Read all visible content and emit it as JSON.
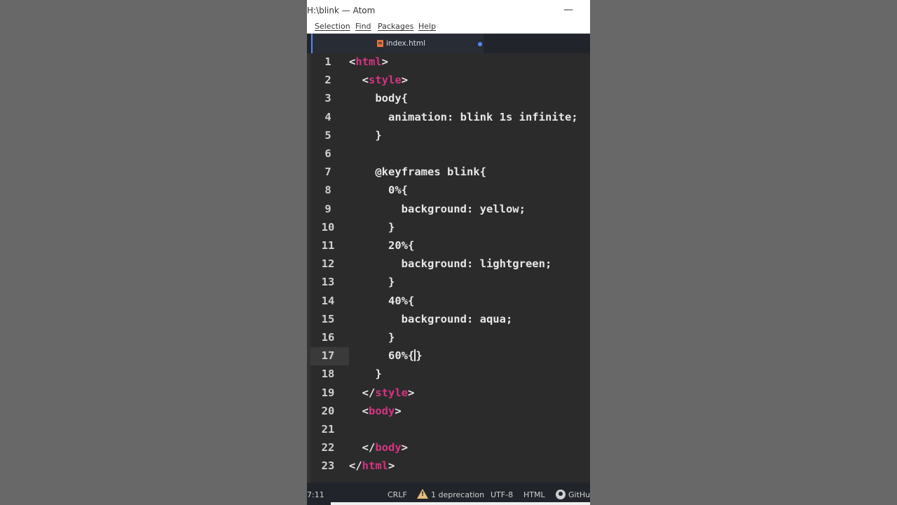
{
  "window": {
    "title": "H:\\blink — Atom",
    "minimize": "—"
  },
  "menu": {
    "items": [
      "Selection",
      "Find",
      "Packages",
      "Help"
    ]
  },
  "tab": {
    "label": "index.html",
    "icon": "html5-file-icon"
  },
  "editor": {
    "lines": [
      {
        "n": "1",
        "indent": 0,
        "parts": [
          [
            "p",
            "<"
          ],
          [
            "t",
            "html"
          ],
          [
            "p",
            ">"
          ]
        ]
      },
      {
        "n": "2",
        "indent": 1,
        "parts": [
          [
            "p",
            "<"
          ],
          [
            "t",
            "style"
          ],
          [
            "p",
            ">"
          ]
        ]
      },
      {
        "n": "3",
        "indent": 2,
        "parts": [
          [
            "p",
            "body{"
          ]
        ]
      },
      {
        "n": "4",
        "indent": 3,
        "parts": [
          [
            "p",
            "animation: blink 1s infinite;"
          ]
        ]
      },
      {
        "n": "5",
        "indent": 2,
        "parts": [
          [
            "p",
            "}"
          ]
        ]
      },
      {
        "n": "6",
        "indent": 0,
        "parts": []
      },
      {
        "n": "7",
        "indent": 2,
        "parts": [
          [
            "p",
            "@keyframes blink{"
          ]
        ]
      },
      {
        "n": "8",
        "indent": 3,
        "parts": [
          [
            "p",
            "0%{"
          ]
        ]
      },
      {
        "n": "9",
        "indent": 4,
        "parts": [
          [
            "p",
            "background: yellow;"
          ]
        ]
      },
      {
        "n": "10",
        "indent": 3,
        "parts": [
          [
            "p",
            "}"
          ]
        ]
      },
      {
        "n": "11",
        "indent": 3,
        "parts": [
          [
            "p",
            "20%{"
          ]
        ]
      },
      {
        "n": "12",
        "indent": 4,
        "parts": [
          [
            "p",
            "background: lightgreen;"
          ]
        ]
      },
      {
        "n": "13",
        "indent": 3,
        "parts": [
          [
            "p",
            "}"
          ]
        ]
      },
      {
        "n": "14",
        "indent": 3,
        "parts": [
          [
            "p",
            "40%{"
          ]
        ]
      },
      {
        "n": "15",
        "indent": 4,
        "parts": [
          [
            "p",
            "background: aqua;"
          ]
        ]
      },
      {
        "n": "16",
        "indent": 3,
        "parts": [
          [
            "p",
            "}"
          ]
        ]
      },
      {
        "n": "17",
        "indent": 3,
        "parts": [
          [
            "p",
            "60%{"
          ],
          [
            "c",
            ""
          ],
          [
            "p",
            "}"
          ]
        ],
        "cursor": true
      },
      {
        "n": "18",
        "indent": 2,
        "parts": [
          [
            "p",
            "}"
          ]
        ]
      },
      {
        "n": "19",
        "indent": 1,
        "parts": [
          [
            "p",
            "</"
          ],
          [
            "t",
            "style"
          ],
          [
            "p",
            ">"
          ]
        ]
      },
      {
        "n": "20",
        "indent": 1,
        "parts": [
          [
            "p",
            "<"
          ],
          [
            "t",
            "body"
          ],
          [
            "p",
            ">"
          ]
        ]
      },
      {
        "n": "21",
        "indent": 0,
        "parts": []
      },
      {
        "n": "22",
        "indent": 1,
        "parts": [
          [
            "p",
            "</"
          ],
          [
            "t",
            "body"
          ],
          [
            "p",
            ">"
          ]
        ]
      },
      {
        "n": "23",
        "indent": 0,
        "parts": [
          [
            "p",
            "</"
          ],
          [
            "t",
            "html"
          ],
          [
            "p",
            ">"
          ]
        ]
      }
    ]
  },
  "status": {
    "cursor_position": "7:11",
    "line_ending": "CRLF",
    "deprecation": "1 deprecation",
    "encoding": "UTF-8",
    "grammar": "HTML",
    "github": "GitHu"
  },
  "colors": {
    "tag": "#d63384",
    "accent": "#568af2",
    "warning": "#e5c07b"
  }
}
